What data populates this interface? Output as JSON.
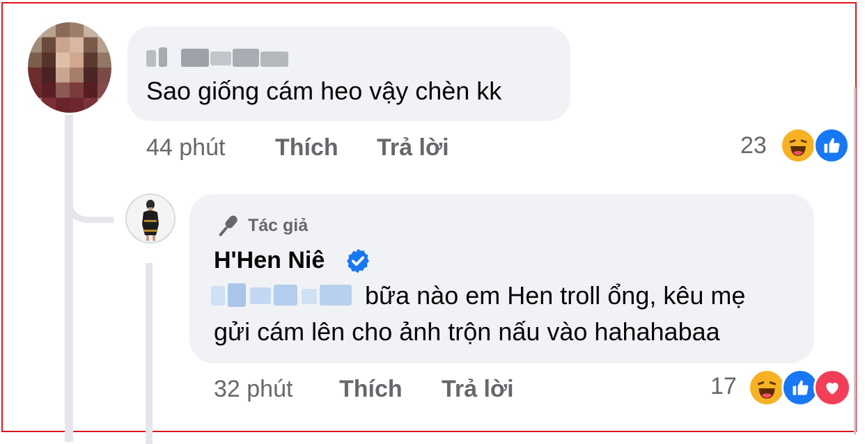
{
  "comment": {
    "author_name_blurred": "",
    "text": "Sao giống cám heo vậy chèn kk",
    "time": "44 phút",
    "like_label": "Thích",
    "reply_label": "Trả lời",
    "reaction_count": "23",
    "reactions": [
      "haha",
      "like"
    ]
  },
  "reply": {
    "badge_label": "Tác giả",
    "author_name": "H'Hen Niê",
    "verified": true,
    "line1": "bữa nào em Hen troll ổng, kêu mẹ",
    "line2": "gửi cám lên cho ảnh trộn nấu vào hahahabaa",
    "time": "32 phút",
    "like_label": "Thích",
    "reply_label": "Trả lời",
    "reaction_count": "17",
    "reactions": [
      "haha",
      "like",
      "love"
    ]
  },
  "colors": {
    "frame": "#e0141e",
    "bubble": "#f0f2f5",
    "meta_text": "#65676b",
    "verified": "#1877f2",
    "like": "#1877f2",
    "love": "#f33e58",
    "haha": "#f7b125"
  },
  "icons": [
    "microphone-icon",
    "verified-badge-icon",
    "haha-reaction-icon",
    "like-reaction-icon",
    "love-reaction-icon"
  ]
}
